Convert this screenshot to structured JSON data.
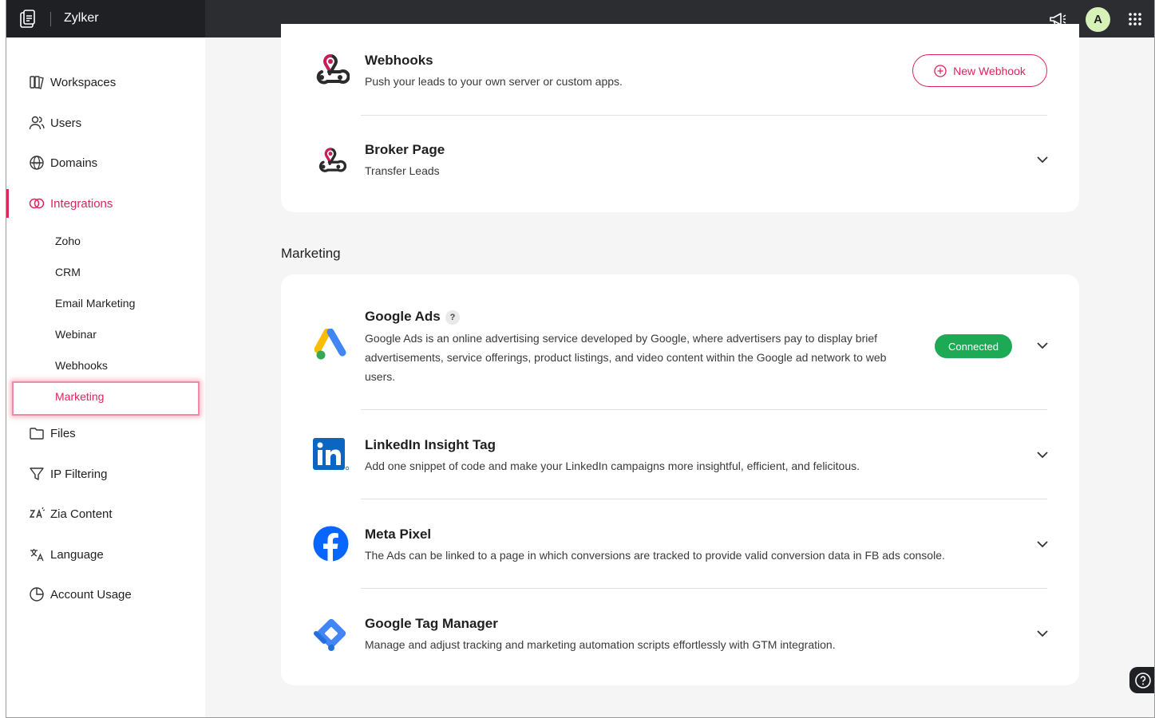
{
  "app": {
    "name": "Zylker",
    "avatar_initial": "A"
  },
  "sidebar": {
    "items": [
      {
        "label": "Workspaces",
        "icon": "workspaces-icon"
      },
      {
        "label": "Users",
        "icon": "users-icon"
      },
      {
        "label": "Domains",
        "icon": "domains-icon"
      },
      {
        "label": "Integrations",
        "icon": "integrations-icon",
        "active": true
      },
      {
        "label": "Files",
        "icon": "folder-icon"
      },
      {
        "label": "IP Filtering",
        "icon": "filter-icon"
      },
      {
        "label": "Zia Content",
        "icon": "zia-content-icon"
      },
      {
        "label": "Language",
        "icon": "language-icon"
      },
      {
        "label": "Account Usage",
        "icon": "pie-chart-icon"
      }
    ],
    "integrations_sub": [
      "Zoho",
      "CRM",
      "Email Marketing",
      "Webinar",
      "Webhooks",
      "Marketing"
    ],
    "active_sub": "Marketing"
  },
  "webhooks_section": {
    "webhooks": {
      "title": "Webhooks",
      "desc": "Push your leads to your own server or custom apps.",
      "button": "New Webhook"
    },
    "broker": {
      "title": "Broker Page",
      "desc": "Transfer Leads"
    }
  },
  "marketing": {
    "section_title": "Marketing",
    "google_ads": {
      "title": "Google Ads",
      "help": "?",
      "desc_line1": "Google Ads is an online advertising service developed by Google, where advertisers pay to display brief",
      "desc_line2": "advertisements, service offerings, product listings, and video content within the Google ad network to web",
      "desc_line3": "users.",
      "status": "Connected"
    },
    "linkedin": {
      "title": "LinkedIn Insight Tag",
      "desc": "Add one snippet of code and make your LinkedIn campaigns more insightful, efficient, and felicitous."
    },
    "meta": {
      "title": "Meta Pixel",
      "desc": "The Ads can be linked to a page in which conversions are tracked to provide valid conversion data in FB ads console."
    },
    "gtm": {
      "title": "Google Tag Manager",
      "desc": "Manage and adjust tracking and marketing automation scripts effortlessly with GTM integration."
    }
  },
  "colors": {
    "accent": "#e3225c",
    "connected": "#1eaa55",
    "topbar": "#2b2d31"
  }
}
